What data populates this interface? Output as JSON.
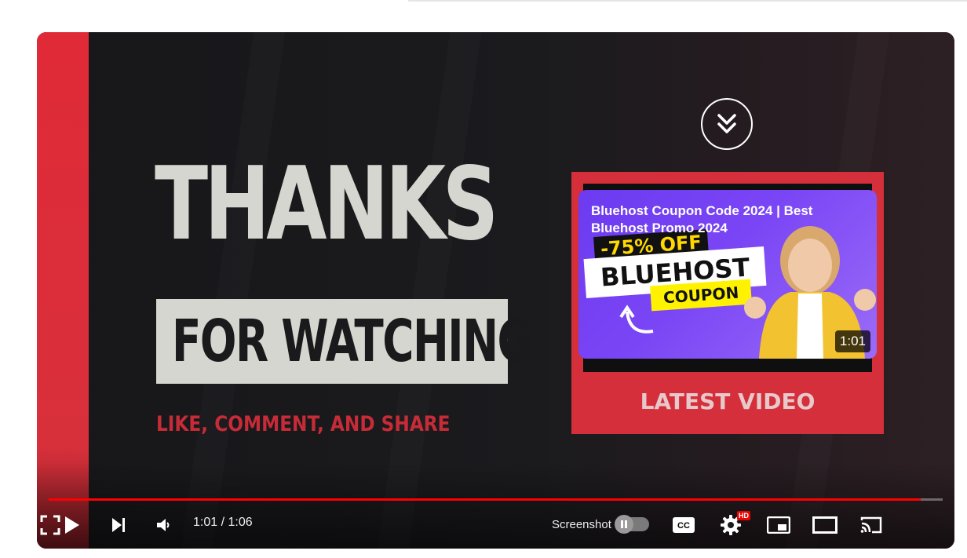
{
  "video": {
    "end_screen": {
      "headline": "THANKS",
      "banner": "FOR WATCHING",
      "call_to_action": "LIKE, COMMENT, AND SHARE",
      "latest_label": "LATEST VIDEO"
    },
    "suggested": {
      "title": "Bluehost Coupon Code 2024 | Best Bluehost Promo 2024",
      "duration": "1:01",
      "thumb_discount": "-75% OFF",
      "thumb_brand": "BLUEHOST",
      "thumb_coupon": "COUPON"
    }
  },
  "controls": {
    "time_display": "1:01 / 1:06",
    "progress": 0.975,
    "screenshot_label": "Screenshot",
    "hd_badge": "HD",
    "icons": [
      "play-icon",
      "next-icon",
      "volume-icon",
      "pause-icon",
      "captions-icon",
      "settings-icon",
      "miniplayer-icon",
      "theater-icon",
      "cast-icon",
      "fullscreen-icon",
      "chevron-down-double-icon"
    ]
  },
  "colors": {
    "accent_red": "#ff0000",
    "brand_red": "#d42f3a",
    "thumb_purple": "#7a45f5"
  }
}
